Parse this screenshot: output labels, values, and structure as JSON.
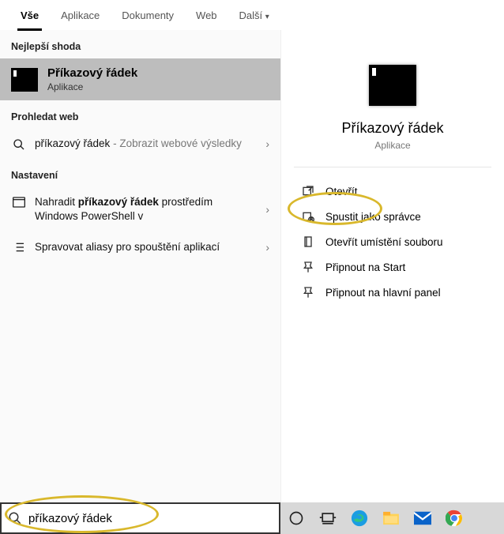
{
  "tabs": [
    "Vše",
    "Aplikace",
    "Dokumenty",
    "Web",
    "Další"
  ],
  "sections": {
    "best_match": "Nejlepší shoda",
    "search_web": "Prohledat web",
    "settings": "Nastavení"
  },
  "best": {
    "title": "Příkazový řádek",
    "subtitle": "Aplikace"
  },
  "web": {
    "query": "příkazový řádek",
    "suffix_dash": "-",
    "suffix": "Zobrazit webové výsledky"
  },
  "settings": [
    {
      "pre": "Nahradit",
      "bold": "příkazový řádek",
      "post": "prostředím Windows PowerShell v"
    },
    {
      "text": "Spravovat aliasy pro spouštění aplikací"
    }
  ],
  "preview": {
    "title": "Příkazový řádek",
    "subtitle": "Aplikace",
    "actions": [
      "Otevřít",
      "Spustit jako správce",
      "Otevřít umístění souboru",
      "Připnout na Start",
      "Připnout na hlavní panel"
    ]
  },
  "search": {
    "value": "příkazový řádek"
  },
  "annotation": {
    "color": "#d9b82c",
    "highlights": [
      "action-open",
      "search-input"
    ]
  }
}
